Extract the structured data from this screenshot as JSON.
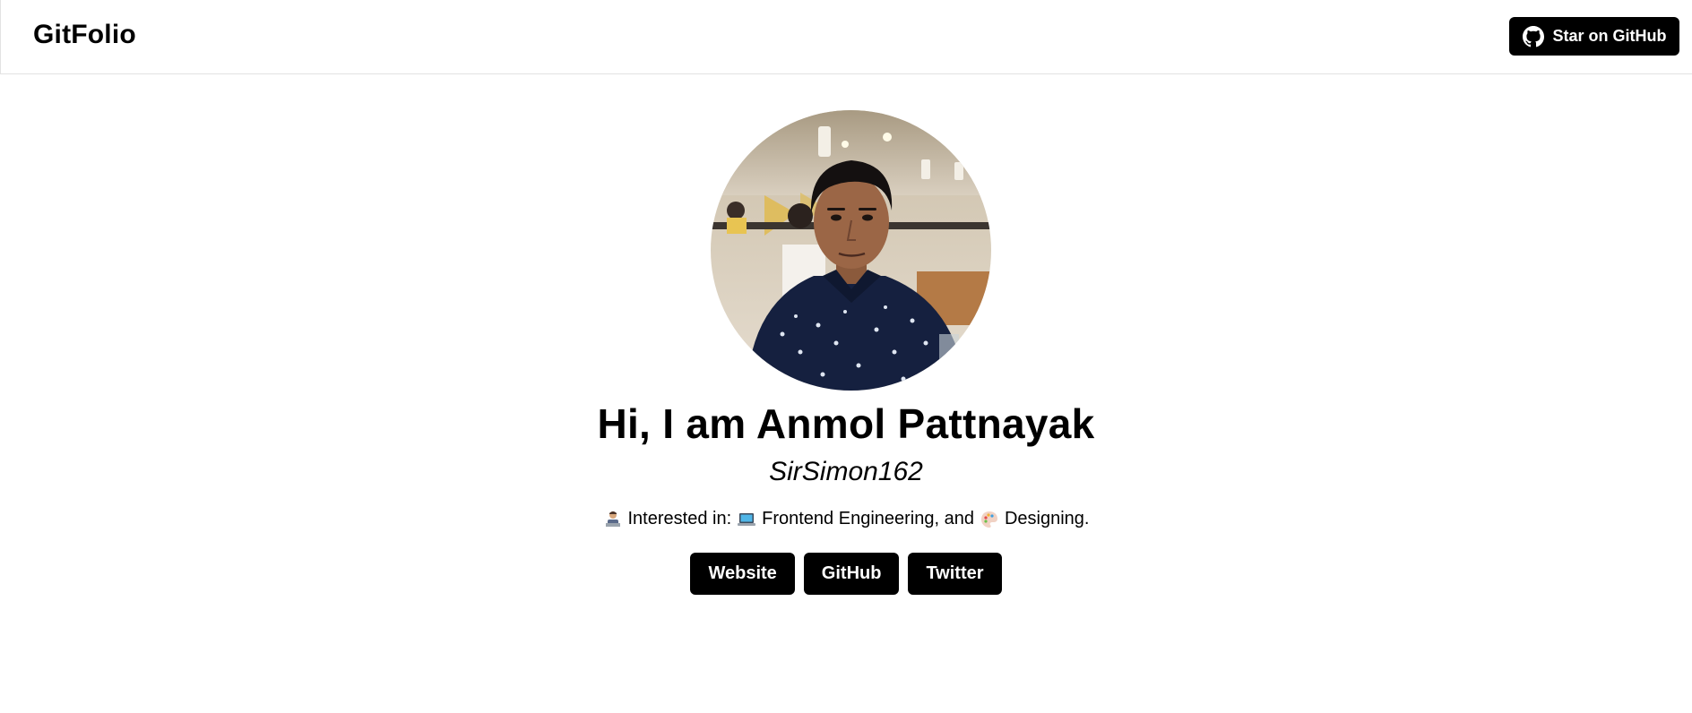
{
  "navbar": {
    "brand": "GitFolio",
    "star_label": "Star on GitHub",
    "star_icon": "github-icon"
  },
  "profile": {
    "avatar_alt": "profile-photo",
    "headline": "Hi, I am Anmol Pattnayak",
    "username": "SirSimon162",
    "interests": {
      "lead_icon": "person-at-laptop-emoji",
      "prefix": "Interested in:",
      "item1_icon": "laptop-emoji",
      "item1": "Frontend Engineering, and",
      "item2_icon": "palette-emoji",
      "item2": "Designing."
    }
  },
  "links": [
    {
      "label": "Website"
    },
    {
      "label": "GitHub"
    },
    {
      "label": "Twitter"
    }
  ],
  "colors": {
    "button_bg": "#000000",
    "button_text": "#ffffff",
    "background": "#ffffff"
  }
}
